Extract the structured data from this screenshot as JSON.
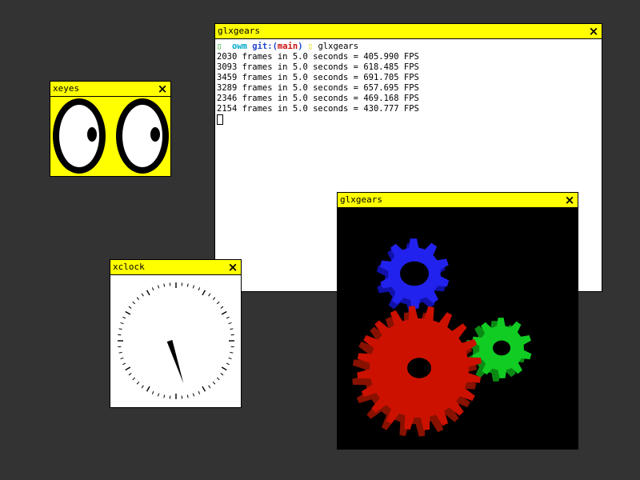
{
  "terminal": {
    "title": "glxgears",
    "close_icon": "×",
    "prompt": {
      "marker": "▯",
      "cwd": "owm",
      "git_prefix": "git:(",
      "branch": "main",
      "git_suffix": ")",
      "arrow": "▯",
      "command": "glxgears"
    },
    "lines": [
      "2030 frames in 5.0 seconds = 405.990 FPS",
      "3093 frames in 5.0 seconds = 618.485 FPS",
      "3459 frames in 5.0 seconds = 691.705 FPS",
      "3289 frames in 5.0 seconds = 657.695 FPS",
      "2346 frames in 5.0 seconds = 469.168 FPS",
      "2154 frames in 5.0 seconds = 430.777 FPS"
    ]
  },
  "xeyes": {
    "title": "xeyes",
    "close_icon": "×"
  },
  "xclock": {
    "title": "xclock",
    "close_icon": "×",
    "hour_hand_angle_deg": 162,
    "minute_hand_angle_deg": 162
  },
  "glxgears": {
    "title": "glxgears",
    "close_icon": "×",
    "gear_colors": {
      "red": "#cc1100",
      "green": "#11cc22",
      "blue": "#2222ee"
    }
  },
  "colors": {
    "desktop": "#333333",
    "titlebar": "#ffff00"
  }
}
